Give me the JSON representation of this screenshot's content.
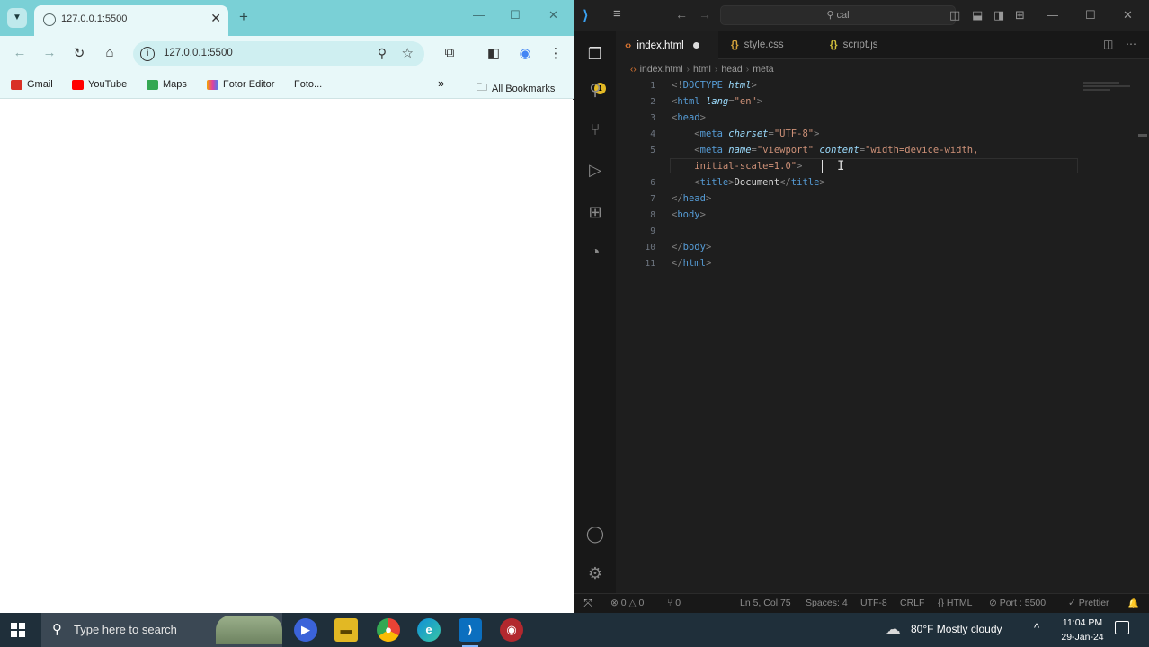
{
  "browser": {
    "tab": {
      "title": "127.0.0.1:5500"
    },
    "address": {
      "url": "127.0.0.1:5500"
    },
    "bookmarks": [
      {
        "label": "Gmail",
        "color": "#d93025"
      },
      {
        "label": "YouTube",
        "color": "#ff0000"
      },
      {
        "label": "Maps",
        "color": "#34a853"
      },
      {
        "label": "Fotor Editor",
        "color": "#f4a300"
      },
      {
        "label": "Foto...",
        "color": ""
      }
    ],
    "all_bookmarks": "All Bookmarks"
  },
  "vscode": {
    "search": "cal",
    "tabs": [
      {
        "label": "index.html",
        "icon": "<>",
        "modified": true
      },
      {
        "label": "style.css",
        "icon": "{}"
      },
      {
        "label": "script.js",
        "icon": "{}"
      }
    ],
    "breadcrumbs": [
      "index.html",
      "html",
      "head",
      "meta"
    ],
    "line_numbers": [
      "1",
      "2",
      "3",
      "4",
      "5",
      "",
      "6",
      "7",
      "8",
      "9",
      "10",
      "11"
    ],
    "status": {
      "errors": "⊗ 0 △ 0",
      "ports": "⑂ 0",
      "position": "Ln 5, Col 75",
      "spaces": "Spaces: 4",
      "encoding": "UTF-8",
      "eol": "CRLF",
      "language": "{} HTML",
      "port": "⊘ Port : 5500",
      "prettier": "✓ Prettier",
      "bell": "🔔"
    }
  },
  "taskbar": {
    "search_placeholder": "Type here to search",
    "weather": "80°F  Mostly cloudy",
    "time": "11:04 PM",
    "date": "29-Jan-24"
  }
}
